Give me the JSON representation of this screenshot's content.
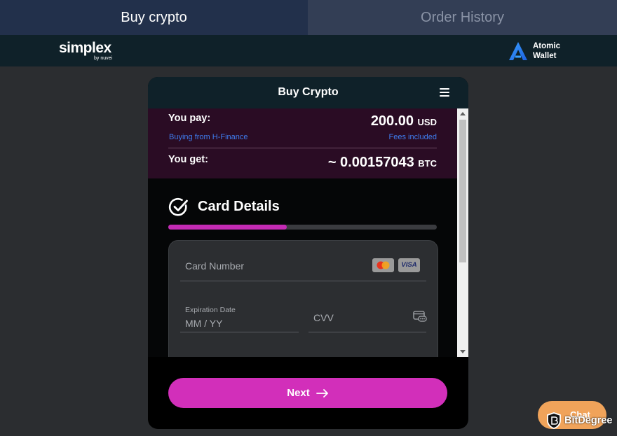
{
  "tabs": [
    {
      "label": "Buy crypto",
      "active": true
    },
    {
      "label": "Order History",
      "active": false
    }
  ],
  "brand": {
    "simplex_name": "simplex",
    "simplex_by": "by nuvei",
    "atomic_line1": "Atomic",
    "atomic_line2": "Wallet"
  },
  "widget": {
    "title": "Buy Crypto",
    "menu_icon": "hamburger-icon",
    "pay": {
      "label": "You pay:",
      "amount": "200.00",
      "currency": "USD",
      "source": "Buying from H-Finance",
      "fees_note": "Fees included"
    },
    "get": {
      "label": "You get:",
      "amount": "~ 0.00157043",
      "currency": "BTC"
    },
    "card_section": {
      "title": "Card Details",
      "progress_fraction": 0.44,
      "card_number_placeholder": "Card Number",
      "visa_text": "VISA",
      "expiration_label": "Expiration Date",
      "expiration_placeholder": "MM / YY",
      "cvv_placeholder": "CVV"
    },
    "next_button": "Next"
  },
  "chat": {
    "label": "Chat"
  },
  "watermark": {
    "text": "BitDegree"
  },
  "colors": {
    "accent": "#d22fba",
    "summary_bg": "#2a0c24",
    "link_blue": "#3f7df0",
    "tab_active": "#22304b",
    "tab_inactive": "#333e55"
  }
}
